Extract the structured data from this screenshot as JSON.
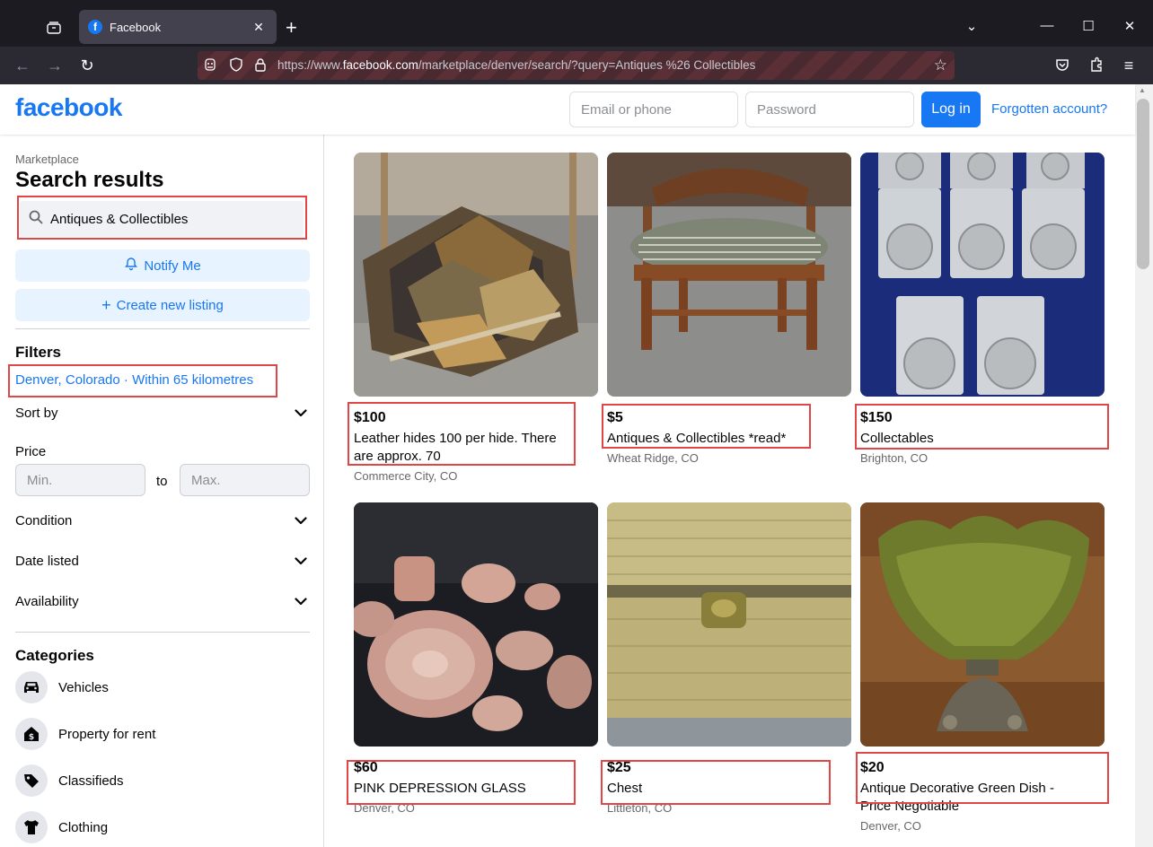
{
  "browser": {
    "tab_title": "Facebook",
    "url_prefix": "https://www.",
    "url_domain": "facebook.com",
    "url_path": "/marketplace/denver/search/?query=Antiques %26 Collectibles"
  },
  "header": {
    "logo": "facebook",
    "email_placeholder": "Email or phone",
    "password_placeholder": "Password",
    "login_label": "Log in",
    "forgot_label": "Forgotten account?"
  },
  "sidebar": {
    "breadcrumb": "Marketplace",
    "title": "Search results",
    "search_value": "Antiques & Collectibles",
    "notify_label": "Notify Me",
    "create_label": "Create new listing",
    "filters_heading": "Filters",
    "location_link": "Denver, Colorado · Within 65 kilometres",
    "sort_by": "Sort by",
    "price_label": "Price",
    "price_min_placeholder": "Min.",
    "price_to": "to",
    "price_max_placeholder": "Max.",
    "condition": "Condition",
    "date_listed": "Date listed",
    "availability": "Availability",
    "categories_heading": "Categories",
    "categories": [
      {
        "label": "Vehicles",
        "icon": "car-icon"
      },
      {
        "label": "Property for rent",
        "icon": "house-dollar-icon"
      },
      {
        "label": "Classifieds",
        "icon": "tag-icon"
      },
      {
        "label": "Clothing",
        "icon": "shirt-icon"
      }
    ]
  },
  "listings": [
    {
      "price": "$100",
      "title": "Leather hides 100 per hide. There are approx. 70",
      "location": "Commerce City, CO",
      "photo": "leather-hides"
    },
    {
      "price": "$5",
      "title": "Antiques & Collectibles *read*",
      "location": "Wheat Ridge, CO",
      "photo": "upholstered-stool"
    },
    {
      "price": "$150",
      "title": "Collectables",
      "location": "Brighton, CO",
      "photo": "graded-silver-coins"
    },
    {
      "price": "$60",
      "title": "PINK DEPRESSION GLASS",
      "location": "Denver, CO",
      "photo": "pink-glassware"
    },
    {
      "price": "$25",
      "title": "Chest",
      "location": "Littleton, CO",
      "photo": "wicker-chest"
    },
    {
      "price": "$20",
      "title": "Antique Decorative Green Dish - Price Negotiable",
      "location": "Denver, CO",
      "photo": "green-glass-dish"
    }
  ],
  "colors": {
    "brand": "#1877f2",
    "highlight_box": "#e04646",
    "button_tint": "#e7f3ff"
  }
}
